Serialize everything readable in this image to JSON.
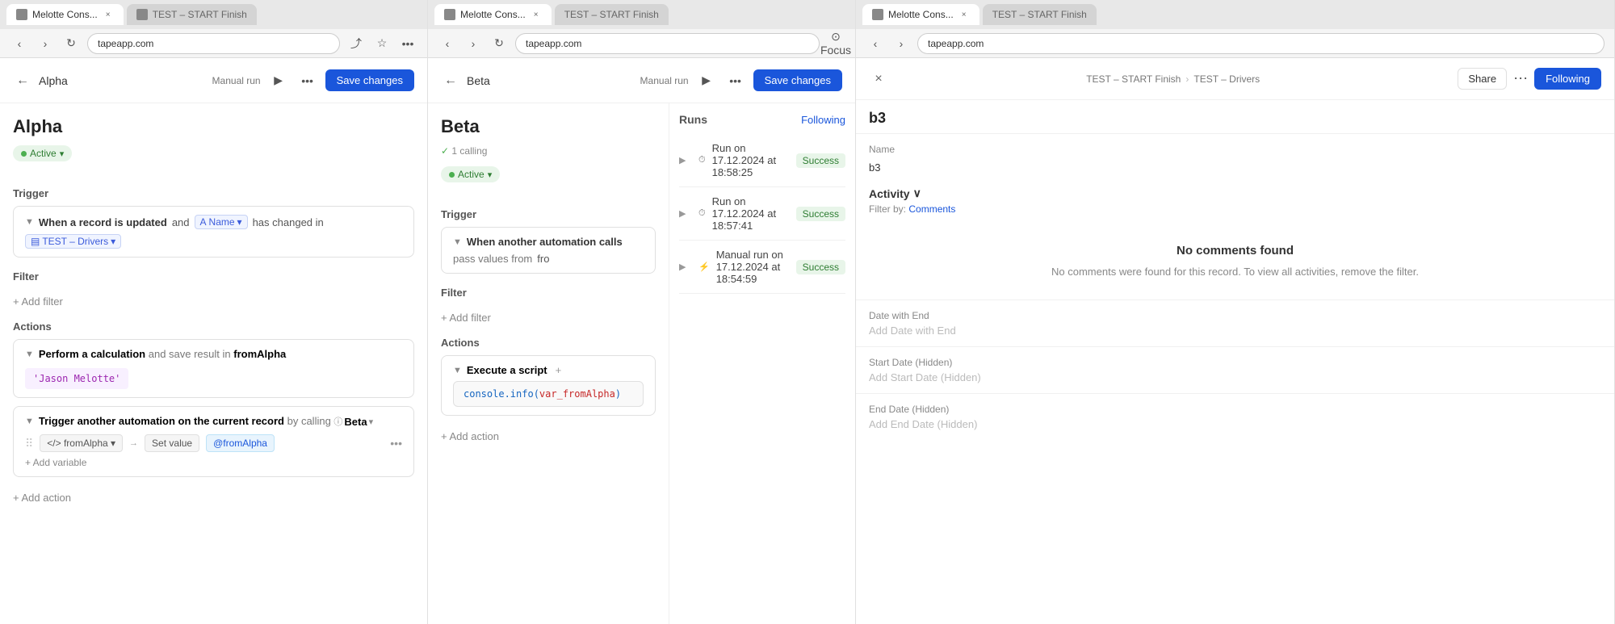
{
  "browser": {
    "url_left": "tapeapp.com",
    "url_middle": "tapeapp.com",
    "url_right": "tapeapp.com",
    "tab_left": "Melotte Cons...",
    "tab_middle": "Melotte Cons...",
    "tab_right": "Melotte Cons..."
  },
  "left_panel": {
    "back_label": "←",
    "title": "Alpha",
    "run_mode": "Manual run",
    "save_label": "Save changes",
    "automation_name": "Alpha",
    "status": "Active",
    "trigger_section": "Trigger",
    "trigger_text": "When a record is updated",
    "trigger_and": "and",
    "trigger_field": "Name",
    "trigger_has_changed": "has changed in",
    "trigger_target": "TEST – Drivers",
    "filter_section": "Filter",
    "add_filter": "+ Add filter",
    "actions_section": "Actions",
    "action1_label": "Perform a calculation",
    "action1_and": "and save result in",
    "action1_target": "fromAlpha",
    "action1_code": "'Jason Melotte'",
    "action2_label": "Trigger another automation on the current record",
    "action2_by_calling": "by calling",
    "action2_target": "Beta",
    "var_from": "fromAlpha",
    "var_set_value": "Set value",
    "var_value": "@fromAlpha",
    "add_variable": "+ Add variable",
    "add_action": "+ Add action"
  },
  "middle_panel": {
    "back_label": "←",
    "title": "Beta",
    "run_mode": "Manual run",
    "save_label": "Save changes",
    "automation_name": "Beta",
    "calling_count": "1 calling",
    "status": "Active",
    "trigger_section": "Trigger",
    "trigger_text": "When another automation calls",
    "trigger_pass": "pass values from",
    "trigger_fro": "fro",
    "filter_section": "Filter",
    "add_filter": "+ Add filter",
    "actions_section": "Actions",
    "action_execute": "Execute a script",
    "script_code": "console.info(var_fromAlpha)",
    "add_action": "+ Add action",
    "runs_section": "Runs",
    "following_label": "Following",
    "runs": [
      {
        "expand": "▶",
        "icon": "⏱",
        "text": "Run on 17.12.2024 at 18:58:25",
        "status": "Success"
      },
      {
        "expand": "▶",
        "icon": "⏱",
        "text": "Run on 17.12.2024 at 18:57:41",
        "status": "Success"
      },
      {
        "expand": "▶",
        "icon": "⚡",
        "text": "Manual run on 17.12.2024 at 18:54:59",
        "status": "Success"
      }
    ]
  },
  "right_panel": {
    "close_label": "×",
    "breadcrumb_part1": "TEST – START Finish",
    "breadcrumb_sep": "›",
    "breadcrumb_part2": "TEST – Drivers",
    "share_label": "Share",
    "following_label": "Following",
    "record_name": "b3",
    "name_label": "Name",
    "name_value": "b3",
    "activity_label": "Activity",
    "activity_chevron": "∨",
    "filter_by": "Filter by:",
    "filter_link": "Comments",
    "no_comments_title": "No comments found",
    "no_comments_text": "No comments were found for this record. To view all activities, remove the filter.",
    "date_with_end_label": "Date with End",
    "date_with_end_add": "Add Date with End",
    "start_date_label": "Start Date (Hidden)",
    "start_date_add": "Add Start Date (Hidden)",
    "end_date_label": "End Date (Hidden)",
    "end_date_add": "Add End Date (Hidden)"
  }
}
